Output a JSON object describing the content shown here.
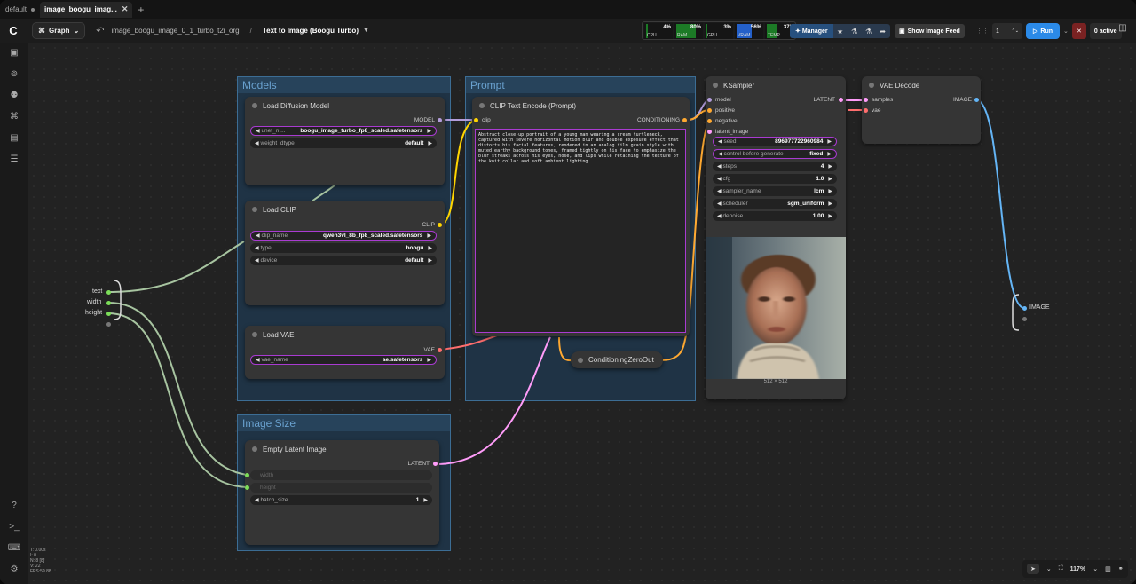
{
  "tabs": [
    {
      "label": "default"
    },
    {
      "label": "image_boogu_imag..."
    }
  ],
  "topbar": {
    "graph_label": "Graph",
    "breadcrumb": "image_boogu_image_0_1_turbo_t2i_org",
    "workflow_title": "Text to Image (Boogu Turbo)"
  },
  "monitors": [
    {
      "label": "CPU",
      "value": "4%",
      "fill": 0.04
    },
    {
      "label": "RAM",
      "value": "80%",
      "fill": 0.8
    },
    {
      "label": "GPU",
      "value": "3%",
      "fill": 0.03
    },
    {
      "label": "VRAM",
      "value": "56%",
      "fill": 0.56
    },
    {
      "label": "TEMP",
      "value": "37°",
      "fill": 0.37
    }
  ],
  "manager_label": "Manager",
  "feed_label": "Show Image Feed",
  "queue_count": "1",
  "run_label": "Run",
  "active_label": "0 active",
  "groups": {
    "models": "Models",
    "prompt": "Prompt",
    "image_size": "Image Size"
  },
  "nodes": {
    "load_diffusion": {
      "title": "Load Diffusion Model",
      "output": "MODEL",
      "unet_label": "unet_n ...",
      "unet_value": "boogu_image_turbo_fp8_scaled.safetensors",
      "dtype_label": "weight_dtype",
      "dtype_value": "default"
    },
    "load_clip": {
      "title": "Load CLIP",
      "output": "CLIP",
      "clip_label": "clip_name",
      "clip_value": "qwen3vl_8b_fp8_scaled.safetensors",
      "type_label": "type",
      "type_value": "boogu",
      "device_label": "device",
      "device_value": "default"
    },
    "load_vae": {
      "title": "Load VAE",
      "output": "VAE",
      "vae_label": "vae_name",
      "vae_value": "ae.safetensors"
    },
    "clip_text": {
      "title": "CLIP Text Encode (Prompt)",
      "input": "clip",
      "output": "CONDITIONING",
      "prompt": "Abstract close-up portrait of a young man wearing a cream turtleneck, captured with severe horizontal motion blur and double exposure effect that distorts his facial features, rendered in an analog film grain style with muted earthy background tones, framed tightly on his face to emphasize the blur streaks across his eyes, nose, and lips while retaining the texture of the knit collar and soft ambient lighting."
    },
    "zero_out": {
      "title": "ConditioningZeroOut"
    },
    "ksampler": {
      "title": "KSampler",
      "inputs": [
        "model",
        "positive",
        "negative",
        "latent_image"
      ],
      "output": "LATENT",
      "seed_label": "seed",
      "seed_value": "896977722960984",
      "control_label": "control before generate",
      "control_value": "fixed",
      "steps_label": "steps",
      "steps_value": "4",
      "cfg_label": "cfg",
      "cfg_value": "1.0",
      "sampler_label": "sampler_name",
      "sampler_value": "lcm",
      "scheduler_label": "scheduler",
      "scheduler_value": "sgm_uniform",
      "denoise_label": "denoise",
      "denoise_value": "1.00",
      "image_caption": "512 × 512"
    },
    "vae_decode": {
      "title": "VAE Decode",
      "inputs": [
        "samples",
        "vae"
      ],
      "output": "IMAGE"
    },
    "empty_latent": {
      "title": "Empty Latent Image",
      "output": "LATENT",
      "width_label": "width",
      "height_label": "height",
      "batch_label": "batch_size",
      "batch_value": "1"
    }
  },
  "reroute": {
    "labels": [
      "text",
      "width",
      "height"
    ]
  },
  "output_reroute": "IMAGE",
  "info": "T: 0.00s\nI: 0\nN: 8 [8]\nV: 22\nFPS:59.88",
  "zoom": "117%",
  "colors": {
    "model": "#b39ddb",
    "clip": "#ffd500",
    "vae": "#ff6e6e",
    "latent": "#ff9cf9",
    "conditioning": "#ffa931",
    "image": "#64b5f6",
    "int": "#7cde59"
  }
}
